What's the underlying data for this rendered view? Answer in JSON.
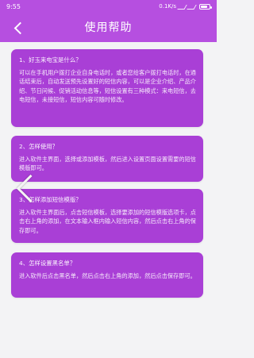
{
  "status_bar": {
    "time": "9:55",
    "net_speed": "0.1K/s",
    "battery": "100"
  },
  "header": {
    "title": "使用帮助",
    "back_icon": "chevron-left-icon",
    "accent_color": "#b64fe0"
  },
  "cards": [
    {
      "question": "1、好玉来电宝是什么？",
      "answer": "可以在手机用户拨打企业自身电话时，或者您给客户拨打电话时，在通话结束后，自动发送预先设置好的短信内容，可以是企业介绍、产品介绍、节日问候、促销活动信息等，短信设置有三种模式：来电短信，去电短信，未接短信，短信内容可随时修改。"
    },
    {
      "question": "2、怎样使用？",
      "answer": "进入软件主界面，选择或添加模板，然后进入设置页面设置需要的短信模版即可。"
    },
    {
      "question": "3、怎样添加短信模版？",
      "answer": "进入软件主界面后，点击短信模板，选择要添加的短信模版选项卡，点击右上角的添加，在文本输入框内输入短信内容，然后点击右上角的保存即可。"
    },
    {
      "question": "4、怎样设置黑名单？",
      "answer": "进入软件后点击黑名单，然后点击右上角的添加，然后点击保存即可。"
    }
  ],
  "card_color": "#a93fd6",
  "overlay": {
    "icon": "chevron-left-icon"
  }
}
